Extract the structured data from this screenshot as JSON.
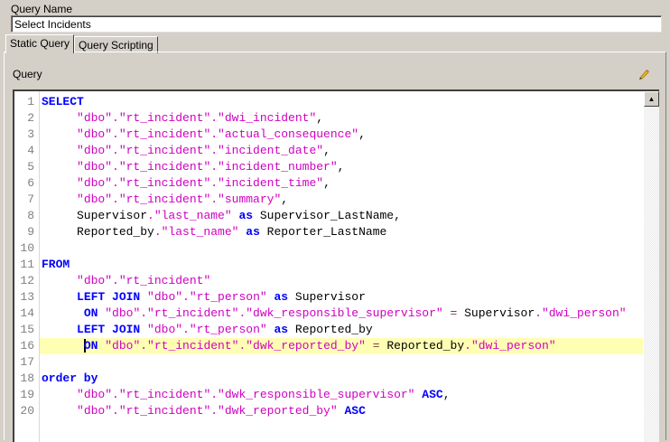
{
  "query_name": {
    "label": "Query Name",
    "value": "Select Incidents"
  },
  "tabs": [
    {
      "label": "Static Query",
      "active": true
    },
    {
      "label": "Query Scripting",
      "active": false
    }
  ],
  "query": {
    "label": "Query",
    "edit_icon": "pencil-icon",
    "current_line": 16
  },
  "colors": {
    "keyword": "#0000ff",
    "string": "#d000c0",
    "operator": "#804040",
    "highlight": "#ffffb4"
  },
  "lines": [
    [
      [
        "k",
        "SELECT"
      ]
    ],
    [
      [
        "p",
        "     "
      ],
      [
        "s",
        "\"dbo\".\"rt_incident\".\"dwi_incident\""
      ],
      [
        "p",
        ","
      ]
    ],
    [
      [
        "p",
        "     "
      ],
      [
        "s",
        "\"dbo\".\"rt_incident\".\"actual_consequence\""
      ],
      [
        "p",
        ","
      ]
    ],
    [
      [
        "p",
        "     "
      ],
      [
        "s",
        "\"dbo\".\"rt_incident\".\"incident_date\""
      ],
      [
        "p",
        ","
      ]
    ],
    [
      [
        "p",
        "     "
      ],
      [
        "s",
        "\"dbo\".\"rt_incident\".\"incident_number\""
      ],
      [
        "p",
        ","
      ]
    ],
    [
      [
        "p",
        "     "
      ],
      [
        "s",
        "\"dbo\".\"rt_incident\".\"incident_time\""
      ],
      [
        "p",
        ","
      ]
    ],
    [
      [
        "p",
        "     "
      ],
      [
        "s",
        "\"dbo\".\"rt_incident\".\"summary\""
      ],
      [
        "p",
        ","
      ]
    ],
    [
      [
        "p",
        "     Supervisor"
      ],
      [
        "s",
        ".\"last_name\""
      ],
      [
        "p",
        " "
      ],
      [
        "k",
        "as"
      ],
      [
        "p",
        " Supervisor_LastName,"
      ]
    ],
    [
      [
        "p",
        "     Reported_by"
      ],
      [
        "s",
        ".\"last_name\""
      ],
      [
        "p",
        " "
      ],
      [
        "k",
        "as"
      ],
      [
        "p",
        " Reporter_LastName"
      ]
    ],
    [],
    [
      [
        "k",
        "FROM"
      ]
    ],
    [
      [
        "p",
        "     "
      ],
      [
        "s",
        "\"dbo\".\"rt_incident\""
      ]
    ],
    [
      [
        "p",
        "     "
      ],
      [
        "k",
        "LEFT JOIN"
      ],
      [
        "p",
        " "
      ],
      [
        "s",
        "\"dbo\".\"rt_person\""
      ],
      [
        "p",
        " "
      ],
      [
        "k",
        "as"
      ],
      [
        "p",
        " Supervisor"
      ]
    ],
    [
      [
        "p",
        "      "
      ],
      [
        "k",
        "ON"
      ],
      [
        "p",
        " "
      ],
      [
        "s",
        "\"dbo\".\"rt_incident\".\"dwk_responsible_supervisor\""
      ],
      [
        "p",
        " "
      ],
      [
        "o",
        "="
      ],
      [
        "p",
        " Supervisor"
      ],
      [
        "s",
        ".\"dwi_person\""
      ]
    ],
    [
      [
        "p",
        "     "
      ],
      [
        "k",
        "LEFT JOIN"
      ],
      [
        "p",
        " "
      ],
      [
        "s",
        "\"dbo\".\"rt_person\""
      ],
      [
        "p",
        " "
      ],
      [
        "k",
        "as"
      ],
      [
        "p",
        " Reported_by"
      ]
    ],
    [
      [
        "p",
        "      "
      ],
      [
        "k",
        "ON"
      ],
      [
        "p",
        " "
      ],
      [
        "s",
        "\"dbo\".\"rt_incident\".\"dwk_reported_by\""
      ],
      [
        "p",
        " "
      ],
      [
        "o",
        "="
      ],
      [
        "p",
        " Reported_by"
      ],
      [
        "s",
        ".\"dwi_person\""
      ]
    ],
    [],
    [
      [
        "k",
        "order by"
      ]
    ],
    [
      [
        "p",
        "     "
      ],
      [
        "s",
        "\"dbo\".\"rt_incident\".\"dwk_responsible_supervisor\""
      ],
      [
        "p",
        " "
      ],
      [
        "k",
        "ASC"
      ],
      [
        "p",
        ","
      ]
    ],
    [
      [
        "p",
        "     "
      ],
      [
        "s",
        "\"dbo\".\"rt_incident\".\"dwk_reported_by\""
      ],
      [
        "p",
        " "
      ],
      [
        "k",
        "ASC"
      ]
    ]
  ]
}
